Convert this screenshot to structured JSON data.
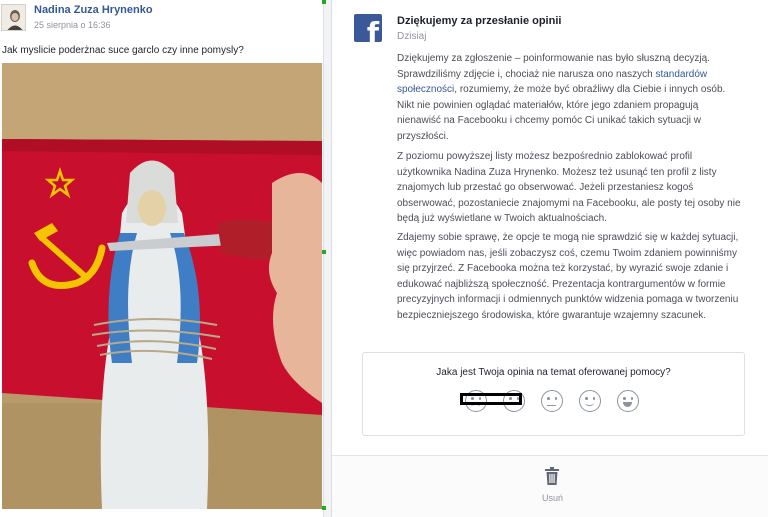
{
  "post": {
    "author": "Nadina Zuza Hrynenko",
    "timestamp": "25 sierpnia o 16:36",
    "text": "Jak myslicie poderżnac suce garclo czy inne pomysly?",
    "photo": {
      "subject": "statue-with-knife-on-flag",
      "flag_color": "#c8102e",
      "emblem_color": "#f5c400"
    }
  },
  "message": {
    "logo_icon": "facebook-logo-icon",
    "title": "Dziękujemy za przesłanie opinii",
    "date": "Dzisiaj",
    "p1_before": "Dziękujemy za zgłoszenie – poinformowanie nas było słuszną decyzją. Sprawdziliśmy zdjęcie i, chociaż nie narusza ono naszych ",
    "p1_link": "standardów społeczności",
    "p1_after": ", rozumiemy, że może być obraźliwy dla Ciebie i innych osób. Nikt nie powinien oglądać materiałów, które jego zdaniem propagują nienawiść na Facebooku i chcemy pomóc Ci unikać takich sytuacji w przyszłości.",
    "p2": "Z poziomu powyższej listy możesz bezpośrednio zablokować profil użytkownika Nadina Zuza Hrynenko. Możesz też usunąć ten profil z listy znajomych lub przestać go obserwować. Jeżeli przestaniesz kogoś obserwować, pozostaniecie znajomymi na Facebooku, ale posty tej osoby nie będą już wyświetlane w Twoich aktualnościach.",
    "p3": "Zdajemy sobie sprawę, że opcje te mogą nie sprawdzić się w każdej sytuacji, więc powiadom nas, jeśli zobaczysz coś, czemu Twoim zdaniem powinniśmy się przyjrzeć. Z Facebooka można też korzystać, by wyrazić swoje zdanie i edukować najbliższą społeczność. Prezentacja kontrargumentów w formie precyzyjnych informacji i odmiennych punktów widzenia pomaga w tworzeniu bezpieczniejszego środowiska, które gwarantuje wzajemny szacunek."
  },
  "rating": {
    "question": "Jaka jest Twoja opinia na temat oferowanej pomocy?",
    "faces": [
      "very-sad-face-icon",
      "sad-face-icon",
      "neutral-face-icon",
      "smile-face-icon",
      "grin-face-icon"
    ]
  },
  "actions": {
    "delete_icon": "trash-icon",
    "delete_label": "Usuń"
  },
  "colors": {
    "accent": "#3b5998",
    "link": "#365899",
    "muted": "#90949c"
  }
}
